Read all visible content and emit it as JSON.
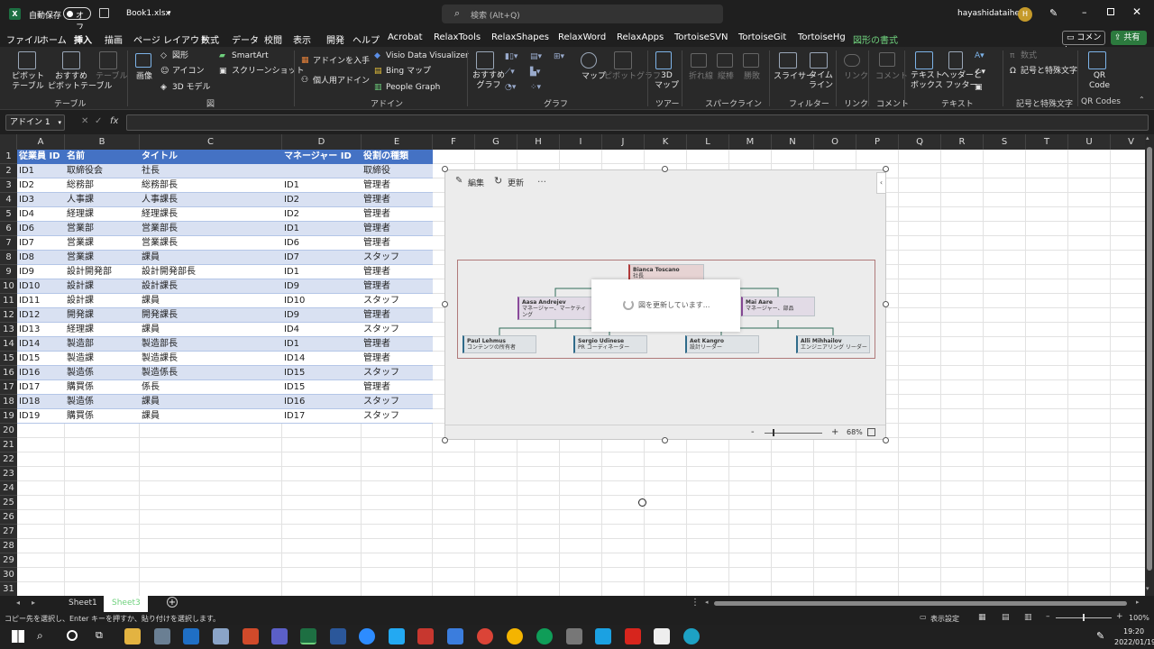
{
  "title_bar": {
    "autosave_label": "自動保存",
    "autosave_state": "オフ",
    "filename": "Book1.xlsx",
    "search_placeholder": "検索 (Alt+Q)",
    "user_name": "hayashidataihei",
    "user_initial": "H"
  },
  "menu": [
    "ファイル",
    "ホーム",
    "挿入",
    "描画",
    "ページ レイアウト",
    "数式",
    "データ",
    "校閲",
    "表示",
    "開発",
    "ヘルプ",
    "Acrobat",
    "RelaxTools",
    "RelaxShapes",
    "RelaxWord",
    "RelaxApps",
    "TortoiseSVN",
    "TortoiseGit",
    "TortoiseHg",
    "図形の書式"
  ],
  "comment_button": "コメント",
  "share_button": "共有",
  "ribbon": {
    "pivot_table": "ピボットテーブル",
    "recommended_pivot": "おすすめ\nピボットテーブル",
    "table": "テーブル",
    "images": "画像",
    "shapes": "図形",
    "icons": "アイコン",
    "model3d": "3D モデル",
    "smartart": "SmartArt",
    "screenshot": "スクリーンショット",
    "get_addins": "アドインを入手",
    "my_addins": "個人用アドイン",
    "visio": "Visio Data Visualizer",
    "bing_map": "Bing マップ",
    "people_graph": "People Graph",
    "recommended_charts": "おすすめ\nグラフ",
    "maps": "マップ",
    "pivot_chart": "ピボットグラフ",
    "map3d": "3D\nマップ",
    "line": "折れ線",
    "column": "縦棒",
    "winloss": "勝敗",
    "slicer": "スライサー",
    "timeline": "タイム\nライン",
    "link": "リンク",
    "comment": "コメント",
    "textbox": "テキスト\nボックス",
    "header_footer": "ヘッダーと\nフッター",
    "equation": "数式",
    "symbol": "記号と特殊文字",
    "qr_code": "QR\nCode",
    "groups": [
      "テーブル",
      "図",
      "アドイン",
      "グラフ",
      "ツアー",
      "スパークライン",
      "フィルター",
      "リンク",
      "コメント",
      "テキスト",
      "記号と特殊文字",
      "QR Codes"
    ]
  },
  "formula_bar": {
    "name_box": "アドイン 1",
    "fx": "fx",
    "value": ""
  },
  "columns": [
    "A",
    "B",
    "C",
    "D",
    "E",
    "F",
    "G",
    "H",
    "I",
    "J",
    "K",
    "L",
    "M",
    "N",
    "O",
    "P",
    "Q",
    "R",
    "S",
    "T",
    "U",
    "V"
  ],
  "table": {
    "headers": [
      "従業員 ID",
      "名前",
      "タイトル",
      "マネージャー ID",
      "役割の種類"
    ],
    "rows": [
      [
        "ID1",
        "取締役会",
        "社長",
        "",
        "取締役"
      ],
      [
        "ID2",
        "総務部",
        "総務部長",
        "ID1",
        "管理者"
      ],
      [
        "ID3",
        "人事課",
        "人事課長",
        "ID2",
        "管理者"
      ],
      [
        "ID4",
        "経理課",
        "経理課長",
        "ID2",
        "管理者"
      ],
      [
        "ID6",
        "営業部",
        "営業部長",
        "ID1",
        "管理者"
      ],
      [
        "ID7",
        "営業課",
        "営業課長",
        "ID6",
        "管理者"
      ],
      [
        "ID8",
        "営業課",
        "課員",
        "ID7",
        "スタッフ"
      ],
      [
        "ID9",
        "設計開発部",
        "設計開発部長",
        "ID1",
        "管理者"
      ],
      [
        "ID10",
        "設計課",
        "設計課長",
        "ID9",
        "管理者"
      ],
      [
        "ID11",
        "設計課",
        "課員",
        "ID10",
        "スタッフ"
      ],
      [
        "ID12",
        "開発課",
        "開発課長",
        "ID9",
        "管理者"
      ],
      [
        "ID13",
        "経理課",
        "課員",
        "ID4",
        "スタッフ"
      ],
      [
        "ID14",
        "製造部",
        "製造部長",
        "ID1",
        "管理者"
      ],
      [
        "ID15",
        "製造課",
        "製造課長",
        "ID14",
        "管理者"
      ],
      [
        "ID16",
        "製造係",
        "製造係長",
        "ID15",
        "スタッフ"
      ],
      [
        "ID17",
        "購買係",
        "係長",
        "ID15",
        "管理者"
      ],
      [
        "ID18",
        "製造係",
        "課員",
        "ID16",
        "スタッフ"
      ],
      [
        "ID19",
        "購買係",
        "課員",
        "ID17",
        "スタッフ"
      ]
    ]
  },
  "addin_panel": {
    "edit": "編集",
    "refresh": "更新",
    "more": "…",
    "loading": "図を更新しています...",
    "zoom_minus": "-",
    "zoom_plus": "+",
    "zoom_level": "68%",
    "nodes": [
      {
        "name": "Bianca Toscano",
        "role": "社長"
      },
      {
        "name": "Aasa Andrejev",
        "role": "マネージャー、マーケティング"
      },
      {
        "name": "Mai Aare",
        "role": "マネージャー、部品"
      },
      {
        "name": "Paul Lehmus",
        "role": "コンテンツの所有者"
      },
      {
        "name": "Sergio Udinese",
        "role": "PR コーディネーター"
      },
      {
        "name": "Aet Kangro",
        "role": "設計リーダー"
      },
      {
        "name": "Alli Mihhailov",
        "role": "エンジニアリング リーダー"
      }
    ]
  },
  "sheets": [
    "Sheet1",
    "Sheet3"
  ],
  "status": {
    "message": "コピー先を選択し、Enter キーを押すか、貼り付けを選択します。",
    "display_settings": "表示設定",
    "zoom": "100%"
  },
  "taskbar": {
    "time": "19:20",
    "date": "2022/01/19"
  }
}
